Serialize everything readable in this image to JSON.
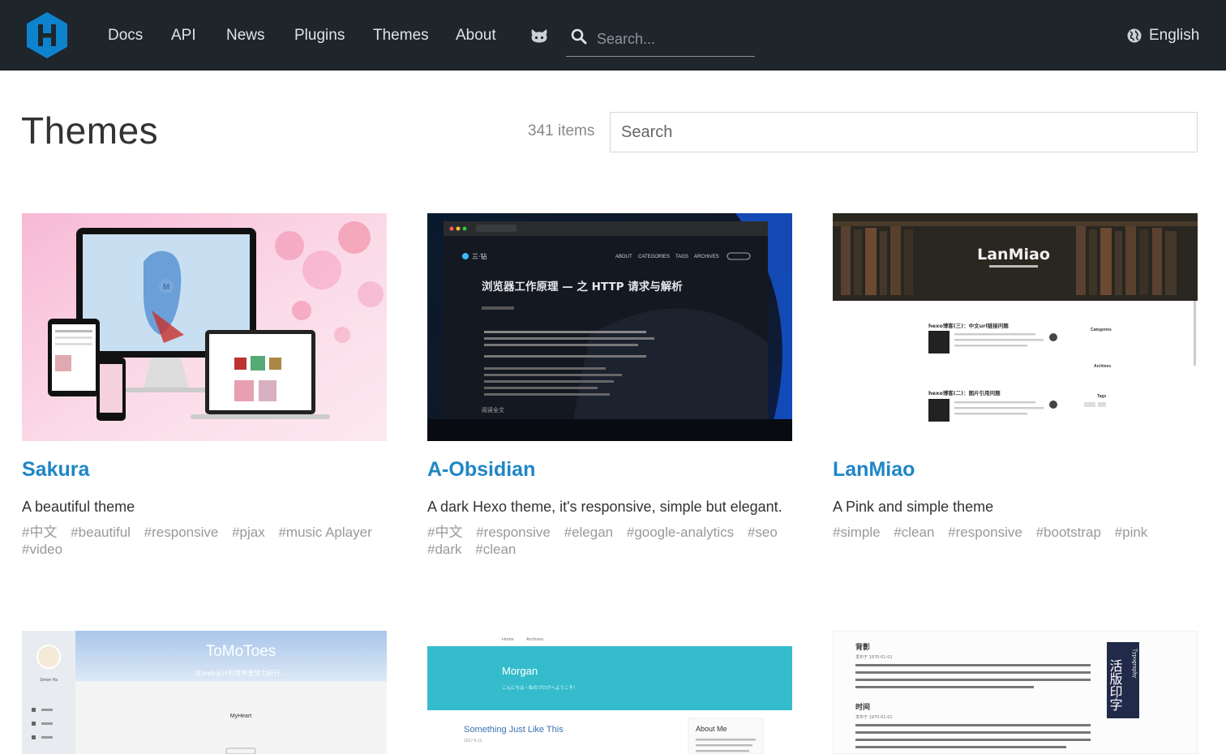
{
  "header": {
    "nav": [
      "Docs",
      "API",
      "News",
      "Plugins",
      "Themes",
      "About"
    ],
    "search_placeholder": "Search...",
    "language": "English"
  },
  "page": {
    "title": "Themes",
    "count": "341 items",
    "filter_placeholder": "Search"
  },
  "themes": [
    {
      "name": "Sakura",
      "description": "A beautiful theme",
      "tags": [
        "#中文",
        "#beautiful",
        "#responsive",
        "#pjax",
        "#music Aplayer",
        "#video"
      ],
      "screenshot": {
        "site_logo": "M"
      }
    },
    {
      "name": "A-Obsidian",
      "description": "A dark Hexo theme, it's responsive, simple but elegant.",
      "tags": [
        "#中文",
        "#responsive",
        "#elegan",
        "#google-analytics",
        "#seo",
        "#dark",
        "#clean"
      ],
      "screenshot": {
        "brand": "三·钻",
        "menu": [
          "ABOUT",
          "CATEGORIES",
          "TAGS",
          "ARCHIVES"
        ],
        "headline": "浏览器工作原理 — 之 HTTP 请求与解析",
        "read_more": "阅读全文"
      }
    },
    {
      "name": "LanMiao",
      "description": "A Pink and simple theme",
      "tags": [
        "#simple",
        "#clean",
        "#responsive",
        "#bootstrap",
        "#pink"
      ],
      "screenshot": {
        "hero_title": "LanMiao",
        "posts": [
          "hexo博客(三)：中文url链接问题",
          "hexo博客(二)：图片引用问题"
        ],
        "sidebar": [
          "Categories",
          "Archives",
          "Tags"
        ]
      }
    }
  ],
  "more_themes": [
    {
      "screenshot": {
        "hero_title": "ToMoToes",
        "subtitle": "在web设计的世界里努力前行...",
        "user": "Simon Ha",
        "post_title": "MyHeart"
      }
    },
    {
      "screenshot": {
        "nav": [
          "Home",
          "Archives"
        ],
        "title": "Morgan",
        "subtitle": "こんにちは・私のブログへようこそ!",
        "post_title": "Something Just Like This",
        "post_meta": "2017-5-11",
        "about_heading": "About Me",
        "about_text": "I am a dedicated person with a family of four. I enjoy reading, and the knowledge and"
      }
    },
    {
      "screenshot": {
        "heading1": "背影",
        "heading2": "时间",
        "meta": "发布于 1970-01-01",
        "side_text": "活版印字",
        "side_text_en": "Typography",
        "para1": "作者：朱自清 我与父亲不相见已二年余了，我最不能忘记的是他的背影。那年冬天，祖母死了，父亲的差使也交卸了，正是祸不单行的日子，我从北京到徐州，打算跟着父亲奔丧回家。到徐州见着父亲，看见满院狼藉的东西，又想起祖母，不禁簌簌地流下眼泪。父亲说：“事已如此，不必难过，好在天无绝人之路！”回家变卖典质，...",
        "para2": "作者：沈从文 一切存在严格地说都需要“时间”。时间证实一切，因为它改变一切。气候寒暑，草木荣枯，人从生到死，都不能缺少时间。都从时间上发生作用。常说到“生命的意义”或“生命的价值”。其实一个人活下去真正的意义和价值，不过占有几十个年头的时间罢了。生前世界没有他，他无意义和价值可言的；活到不能再活..."
      }
    }
  ],
  "colors": {
    "header_bg": "#1e252b",
    "link": "#1f86c7",
    "logo": "#0e83cd"
  }
}
